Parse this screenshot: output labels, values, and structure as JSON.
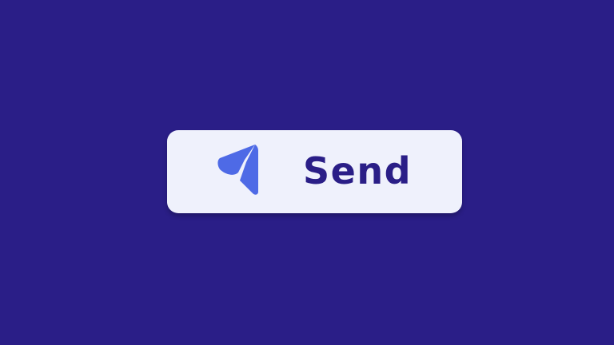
{
  "send_button": {
    "label": "Send",
    "icon": "paper-plane-icon"
  },
  "colors": {
    "background": "#2a1e87",
    "button_background": "#eff1fc",
    "icon": "#4e6ae6",
    "label": "#2a1e87"
  }
}
